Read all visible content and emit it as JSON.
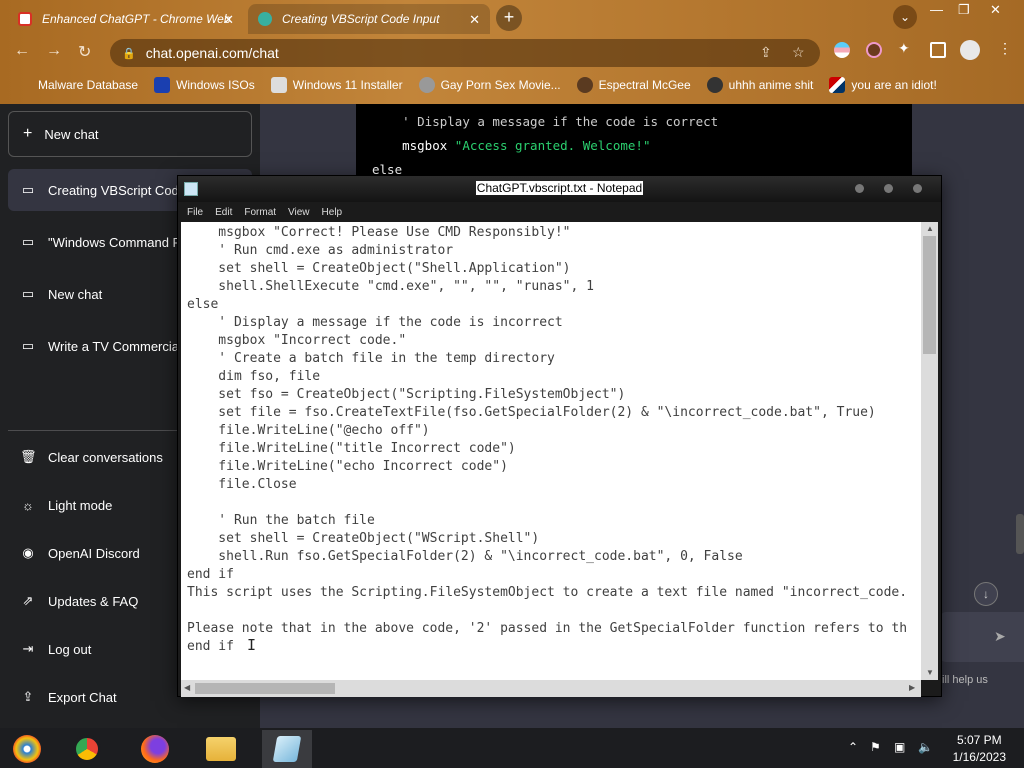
{
  "browser": {
    "tabs": [
      {
        "title": "Enhanced ChatGPT - Chrome Web",
        "close": "✕"
      },
      {
        "title": "Creating VBScript Code Input",
        "close": "✕"
      }
    ],
    "new_tab": "+",
    "url": "chat.openai.com/chat",
    "bookmarks": [
      "Malware Database",
      "Windows ISOs",
      "Windows 11 Installer",
      "Gay Porn Sex Movie...",
      "Espectral McGee",
      "uhhh anime shit",
      "you are an idiot!"
    ]
  },
  "sidebar": {
    "new_chat": "New chat",
    "conversations": [
      "Creating VBScript Code",
      "\"Windows Command P",
      "New chat",
      "Write a TV Commercia"
    ],
    "actions": [
      "Clear conversations",
      "Light mode",
      "OpenAI Discord",
      "Updates & FAQ",
      "Log out",
      "Export Chat"
    ]
  },
  "chat": {
    "code_lines": [
      {
        "indent": "    ",
        "parts": [
          {
            "t": "' Display a message if the code is correct",
            "c": "cmt"
          }
        ]
      },
      {
        "indent": "    ",
        "parts": [
          {
            "t": "msgbox ",
            "c": ""
          },
          {
            "t": "\"Access granted. Welcome!\"",
            "c": "str"
          }
        ]
      },
      {
        "indent": "",
        "parts": [
          {
            "t": "else",
            "c": "kw"
          }
        ]
      }
    ],
    "footer_partial": "ill help us"
  },
  "notepad": {
    "title": "ChatGPT.vbscript.txt - Notepad",
    "menu": [
      "File",
      "Edit",
      "Format",
      "View",
      "Help"
    ],
    "lines": [
      "    msgbox \"Correct! Please Use CMD Responsibly!\"",
      "    ' Run cmd.exe as administrator",
      "    set shell = CreateObject(\"Shell.Application\")",
      "    shell.ShellExecute \"cmd.exe\", \"\", \"\", \"runas\", 1",
      "else",
      "    ' Display a message if the code is incorrect",
      "    msgbox \"Incorrect code.\"",
      "    ' Create a batch file in the temp directory",
      "    dim fso, file",
      "    set fso = CreateObject(\"Scripting.FileSystemObject\")",
      "    set file = fso.CreateTextFile(fso.GetSpecialFolder(2) & \"\\incorrect_code.bat\", True)",
      "    file.WriteLine(\"@echo off\")",
      "    file.WriteLine(\"title Incorrect code\")",
      "    file.WriteLine(\"echo Incorrect code\")",
      "    file.Close",
      "",
      "    ' Run the batch file",
      "    set shell = CreateObject(\"WScript.Shell\")",
      "    shell.Run fso.GetSpecialFolder(2) & \"\\incorrect_code.bat\", 0, False",
      "end if",
      "This script uses the Scripting.FileSystemObject to create a text file named \"incorrect_code.",
      "",
      "Please note that in the above code, '2' passed in the GetSpecialFolder function refers to th",
      "end if"
    ]
  },
  "taskbar": {
    "time": "5:07 PM",
    "date": "1/16/2023"
  }
}
